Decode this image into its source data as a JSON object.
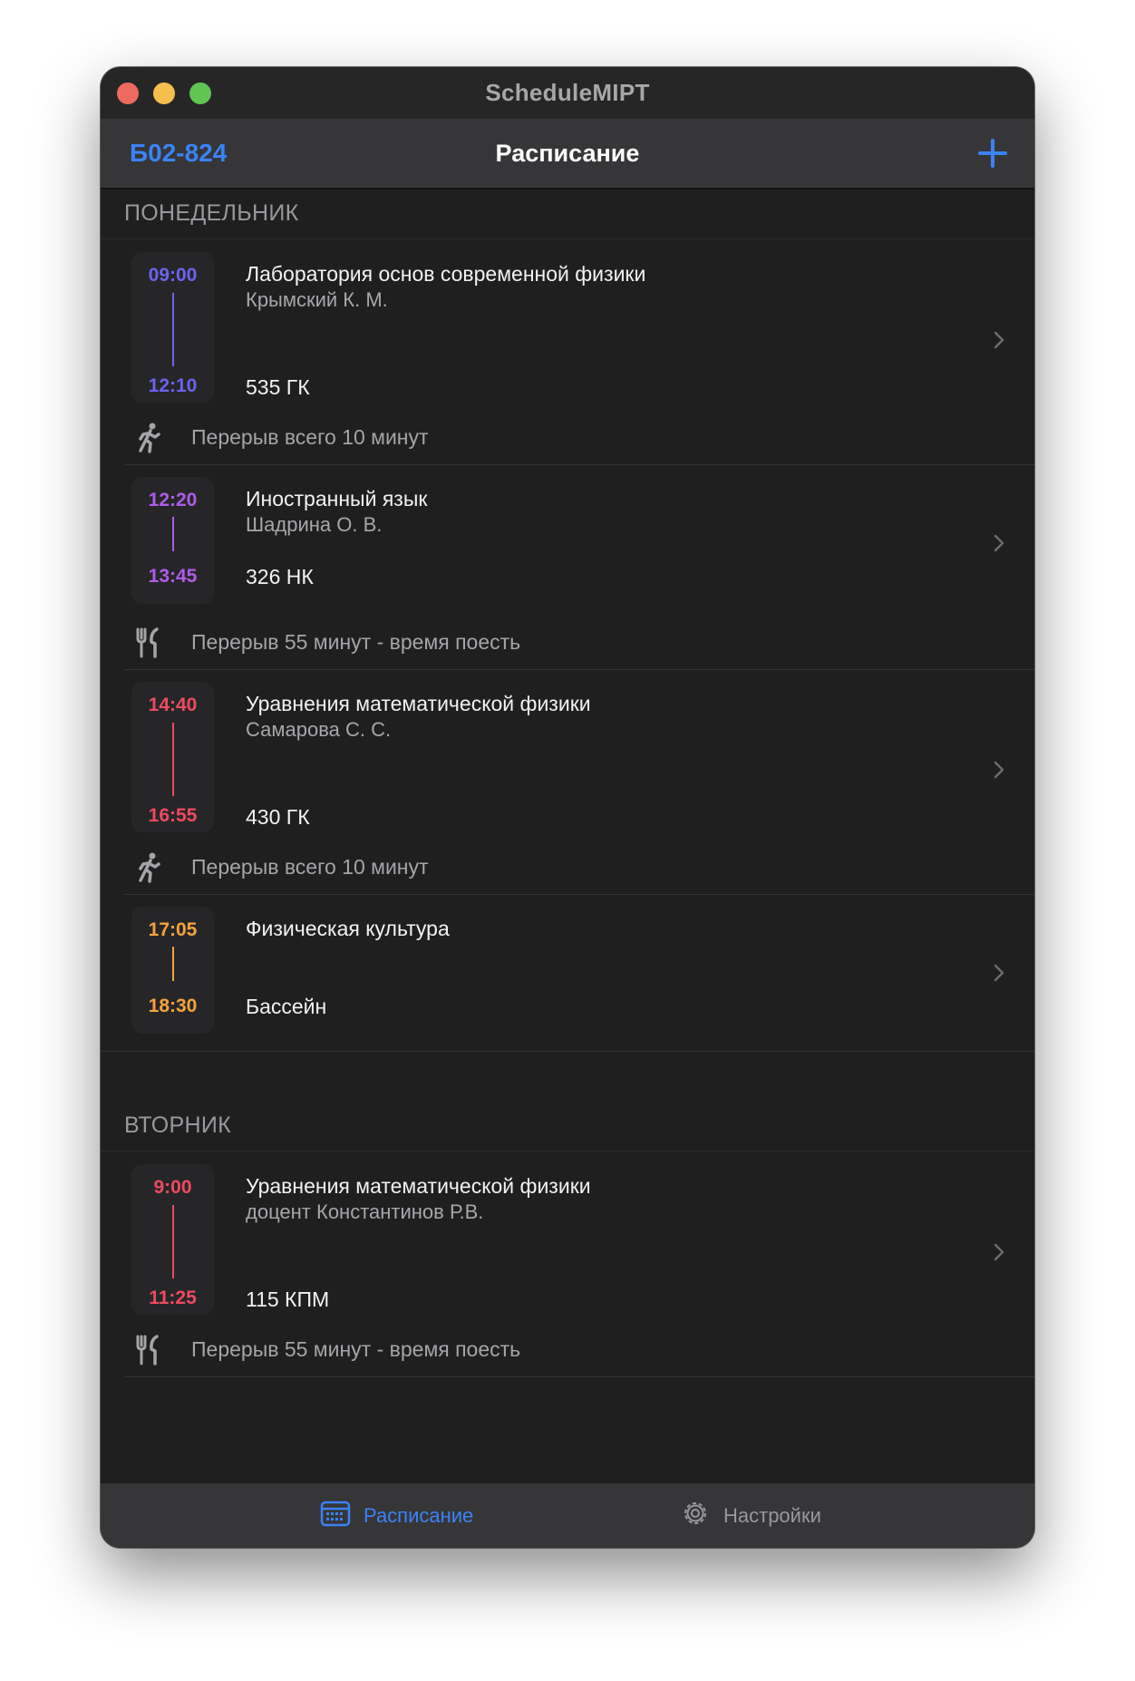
{
  "window": {
    "title": "ScheduleMIPT"
  },
  "navbar": {
    "group": "Б02-824",
    "title": "Расписание"
  },
  "days": [
    {
      "name": "ПОНЕДЕЛЬНИК",
      "lessons": [
        {
          "start": "09:00",
          "end": "12:10",
          "subject": "Лаборатория основ современной физики",
          "teacher": "Крымский К. М.",
          "room": "535 ГК",
          "color": "#6d62f0",
          "break": {
            "icon": "person-running-icon",
            "text": "Перерыв всего 10 минут"
          }
        },
        {
          "start": "12:20",
          "end": "13:45",
          "subject": "Иностранный язык",
          "teacher": "Шадрина О. В.",
          "room": "326 НК",
          "color": "#b15bea",
          "break": {
            "icon": "fork-knife-icon",
            "text": "Перерыв 55 минут - время поесть"
          }
        },
        {
          "start": "14:40",
          "end": "16:55",
          "subject": "Уравнения математической физики",
          "teacher": "Самарова С. С.",
          "room": "430 ГК",
          "color": "#ee4a60",
          "break": {
            "icon": "person-running-icon",
            "text": "Перерыв всего 10 минут"
          }
        },
        {
          "start": "17:05",
          "end": "18:30",
          "subject": "Физическая культура",
          "teacher": "",
          "room": "Бассейн",
          "color": "#f5a33c"
        }
      ]
    },
    {
      "name": "ВТОРНИК",
      "lessons": [
        {
          "start": "9:00",
          "end": "11:25",
          "subject": "Уравнения математической физики",
          "teacher": "доцент Константинов Р.В.",
          "room": "115 КПМ",
          "color": "#ee4a60",
          "break": {
            "icon": "fork-knife-icon",
            "text": "Перерыв 55 минут - время поесть"
          }
        }
      ]
    }
  ],
  "tabbar": {
    "tabs": [
      {
        "label": "Расписание",
        "icon": "calendar-icon",
        "selected": true
      },
      {
        "label": "Настройки",
        "icon": "gear-icon",
        "selected": false
      }
    ]
  },
  "colors": {
    "accent": "#3b82f6",
    "background": "#1f1f20",
    "bar": "#363638"
  }
}
